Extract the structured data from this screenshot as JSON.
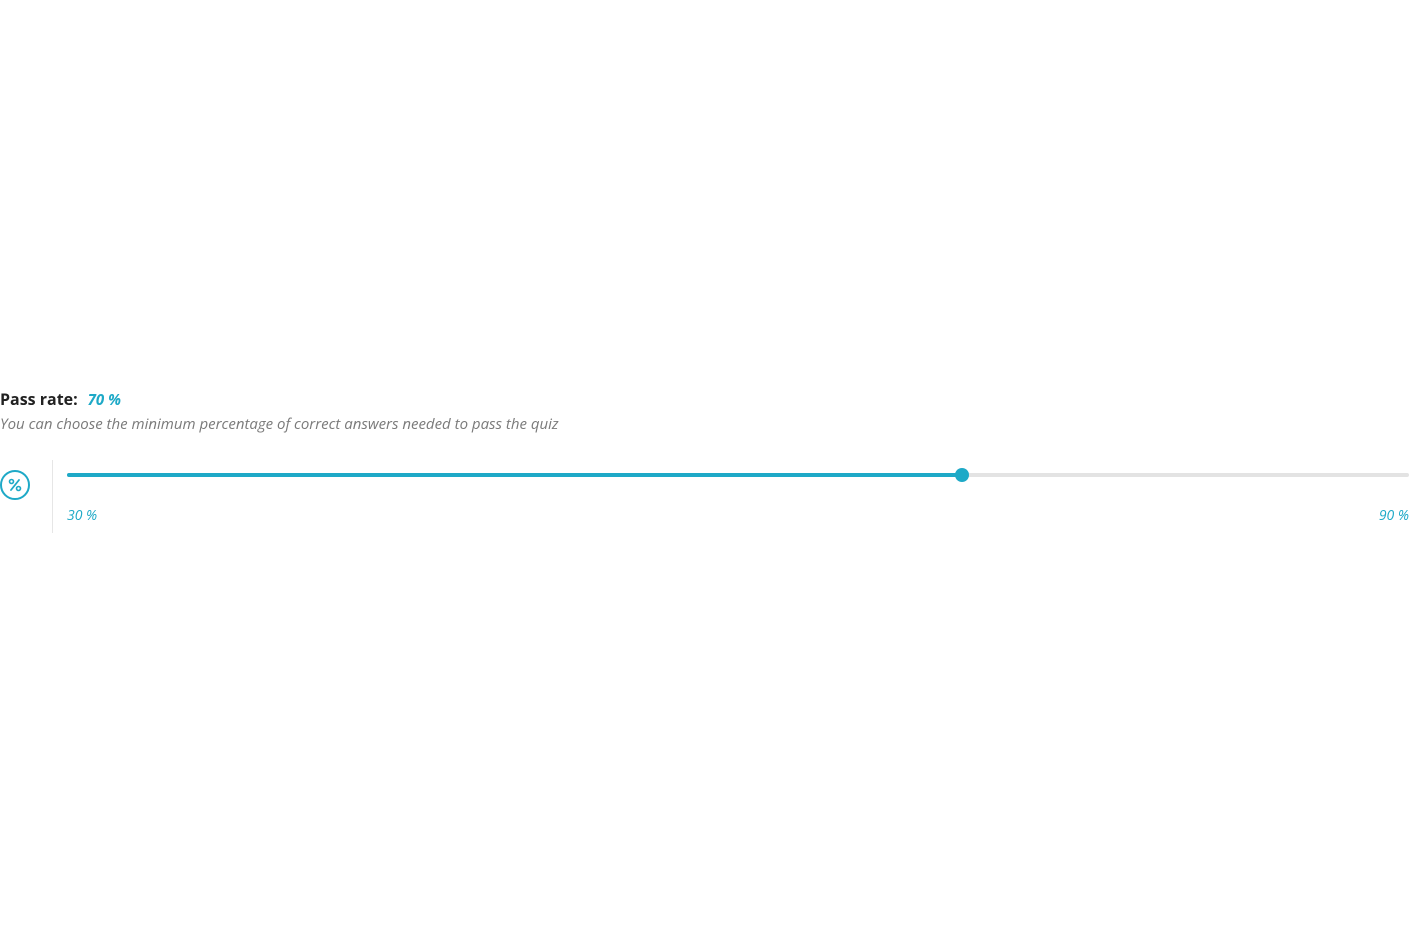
{
  "passRate": {
    "label": "Pass rate:",
    "value": "70 %",
    "description": "You can choose the minimum percentage of correct answers needed to pass the quiz",
    "min": 30,
    "max": 90,
    "current": 70,
    "minLabel": "30 %",
    "maxLabel": "90 %"
  },
  "colors": {
    "accent": "#1ea9c7"
  }
}
